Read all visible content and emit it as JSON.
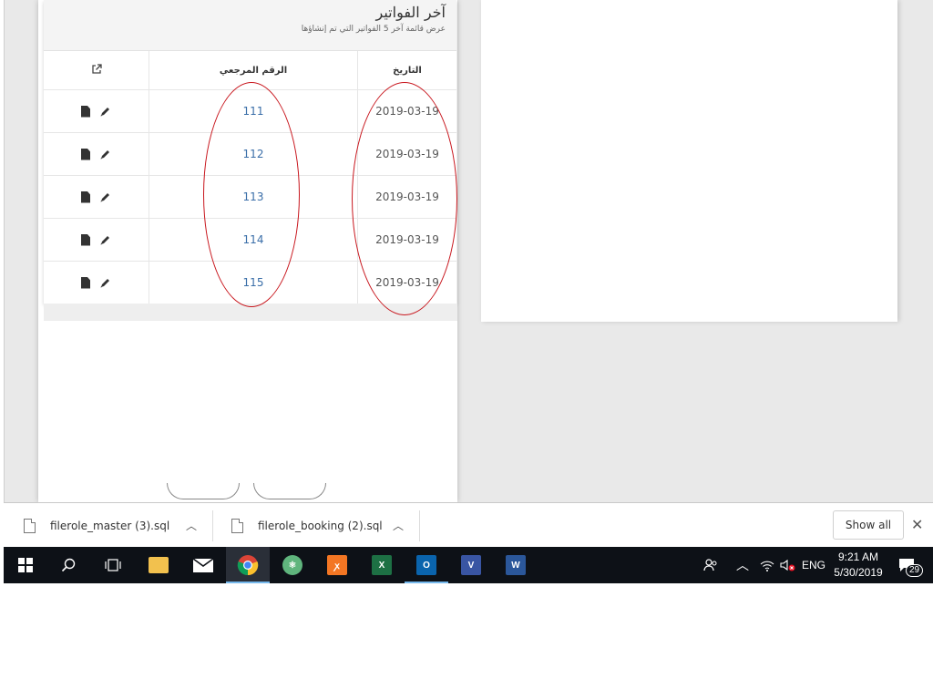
{
  "panel": {
    "title": "آخر الفواتير",
    "subtitle": "عرض قائمة آخر 5 الفواتير التي تم إنشاؤها"
  },
  "table": {
    "headers": {
      "date": "التاريخ",
      "ref": "الرقم المرجعي"
    },
    "rows": [
      {
        "date": "2019-03-19",
        "ref": "111"
      },
      {
        "date": "2019-03-19",
        "ref": "112"
      },
      {
        "date": "2019-03-19",
        "ref": "113"
      },
      {
        "date": "2019-03-19",
        "ref": "114"
      },
      {
        "date": "2019-03-19",
        "ref": "115"
      }
    ]
  },
  "downloads": {
    "items": [
      {
        "name": "filerole_master (3).sql"
      },
      {
        "name": "filerole_booking (2).sql"
      }
    ],
    "show_all": "Show all"
  },
  "taskbar": {
    "language": "ENG",
    "time": "9:21 AM",
    "date": "5/30/2019",
    "notification_count": "29"
  },
  "colors": {
    "annotation": "#c8161d",
    "link": "#3a6ea8",
    "taskbar": "#0d1117"
  }
}
